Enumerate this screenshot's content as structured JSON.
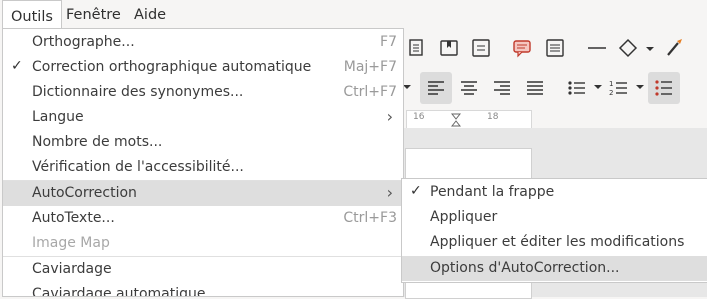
{
  "menubar": {
    "items": [
      {
        "label": "Outils",
        "active": true
      },
      {
        "label": "Fenêtre",
        "active": false
      },
      {
        "label": "Aide",
        "active": false
      }
    ]
  },
  "toolbar": {
    "icons": [
      "insert-page-icon",
      "insert-bookmark-icon",
      "insert-field-icon",
      "insert-comment-icon",
      "track-changes-icon",
      "line-icon",
      "shape-icon",
      "chevron-down-icon",
      "brush-icon",
      "align-left-icon",
      "align-center-icon",
      "align-right-icon",
      "justify-icon",
      "bulleted-list-icon",
      "numbered-list-icon",
      "outline-list-icon"
    ],
    "ruler": {
      "mark_1": "16",
      "mark_2": "18"
    }
  },
  "menu": {
    "items": [
      {
        "label": "Orthographe...",
        "accelerator": "F7"
      },
      {
        "label": "Correction orthographique automatique",
        "accelerator": "Maj+F7",
        "checked": true
      },
      {
        "label": "Dictionnaire des synonymes...",
        "accelerator": "Ctrl+F7"
      },
      {
        "label": "Langue",
        "submenu": true
      },
      {
        "label": "Nombre de mots..."
      },
      {
        "label": "Vérification de l'accessibilité..."
      },
      {
        "label": "AutoCorrection",
        "submenu": true,
        "highlighted": true
      },
      {
        "label": "AutoTexte...",
        "accelerator": "Ctrl+F3"
      },
      {
        "label": "Image Map",
        "disabled": true
      },
      {
        "label": "Caviardage"
      },
      {
        "label": "Caviardage automatique"
      }
    ]
  },
  "submenu": {
    "items": [
      {
        "label": "Pendant la frappe",
        "checked": true
      },
      {
        "label": "Appliquer"
      },
      {
        "label": "Appliquer et éditer les modifications"
      },
      {
        "label": "Options d'AutoCorrection...",
        "highlighted": true
      }
    ]
  },
  "glyphs": {
    "check": "✓",
    "submenu_arrow": "›"
  },
  "colors": {
    "accent": "#e95420",
    "highlight": "#dedede",
    "disabled_text": "#a8a8a8",
    "accelerator_text": "#9a9a9a"
  }
}
